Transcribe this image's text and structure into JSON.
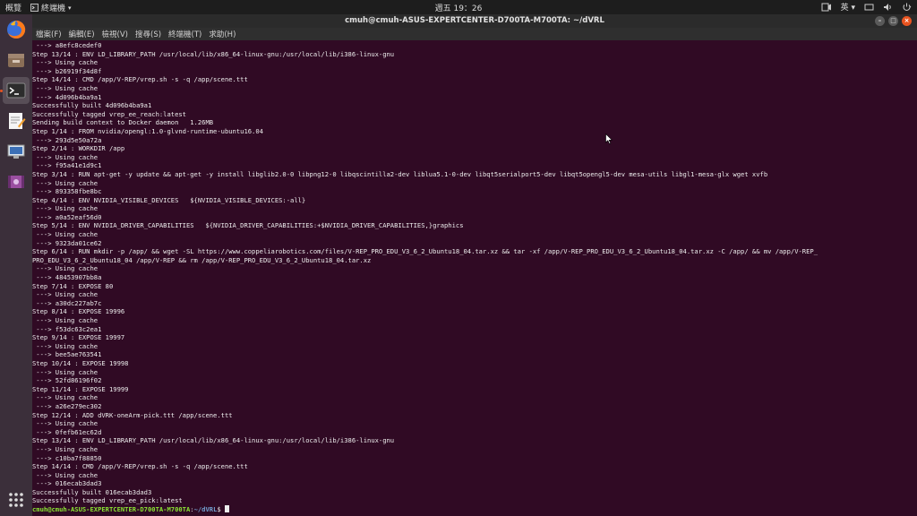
{
  "topbar": {
    "activities": "概覽",
    "app_menu": "終端機",
    "clock": "週五 19：26",
    "input_method": "英"
  },
  "dock": {
    "items": [
      {
        "name": "firefox",
        "icon": "firefox-icon"
      },
      {
        "name": "files",
        "icon": "files-icon"
      },
      {
        "name": "terminal",
        "icon": "terminal-icon"
      },
      {
        "name": "text-editor",
        "icon": "text-editor-icon"
      },
      {
        "name": "installer",
        "icon": "installer-icon"
      },
      {
        "name": "video",
        "icon": "video-icon"
      },
      {
        "name": "show-apps",
        "icon": "apps-grid-icon"
      }
    ]
  },
  "window": {
    "title": "cmuh@cmuh-ASUS-EXPERTCENTER-D700TA-M700TA: ~/dVRL",
    "menu": [
      "檔案(F)",
      "編輯(E)",
      "檢視(V)",
      "搜尋(S)",
      "終端機(T)",
      "求助(H)"
    ]
  },
  "terminal": {
    "lines": [
      " ---> a8efc8cedef0",
      "Step 13/14 : ENV LD_LIBRARY_PATH /usr/local/lib/x86_64-linux-gnu:/usr/local/lib/i386-linux-gnu",
      " ---> Using cache",
      " ---> b26919f34d8f",
      "Step 14/14 : CMD /app/V-REP/vrep.sh -s -q /app/scene.ttt",
      " ---> Using cache",
      " ---> 4d096b4ba9a1",
      "Successfully built 4d096b4ba9a1",
      "Successfully tagged vrep_ee_reach:latest",
      "Sending build context to Docker daemon   1.26MB",
      "Step 1/14 : FROM nvidia/opengl:1.0-glvnd-runtime-ubuntu16.04",
      " ---> 293d5e50a72a",
      "Step 2/14 : WORKDIR /app",
      " ---> Using cache",
      " ---> f95a41e1d9c1",
      "Step 3/14 : RUN apt-get -y update && apt-get -y install libglib2.0-0 libpng12-0 libqscintilla2-dev liblua5.1-0-dev libqt5serialport5-dev libqt5opengl5-dev mesa-utils libgl1-mesa-glx wget xvfb",
      " ---> Using cache",
      " ---> 893358fbe8bc",
      "Step 4/14 : ENV NVIDIA_VISIBLE_DEVICES   ${NVIDIA_VISIBLE_DEVICES:-all}",
      " ---> Using cache",
      " ---> a0a52eaf56d0",
      "Step 5/14 : ENV NVIDIA_DRIVER_CAPABILITIES   ${NVIDIA_DRIVER_CAPABILITIES:+$NVIDIA_DRIVER_CAPABILITIES,}graphics",
      " ---> Using cache",
      " ---> 9323da01ce62",
      "Step 6/14 : RUN mkdir -p /app/ && wget -SL https://www.coppeliarobotics.com/files/V-REP_PRO_EDU_V3_6_2_Ubuntu18_04.tar.xz && tar -xf /app/V-REP_PRO_EDU_V3_6_2_Ubuntu18_04.tar.xz -C /app/ && mv /app/V-REP_",
      "PRO_EDU_V3_6_2_Ubuntu18_04 /app/V-REP && rm /app/V-REP_PRO_EDU_V3_6_2_Ubuntu18_04.tar.xz",
      " ---> Using cache",
      " ---> 48453907bb8a",
      "Step 7/14 : EXPOSE 80",
      " ---> Using cache",
      " ---> a30dc227ab7c",
      "Step 8/14 : EXPOSE 19996",
      " ---> Using cache",
      " ---> f53dc63c2ea1",
      "Step 9/14 : EXPOSE 19997",
      " ---> Using cache",
      " ---> bee5ae763541",
      "Step 10/14 : EXPOSE 19998",
      " ---> Using cache",
      " ---> 52fd86196f02",
      "Step 11/14 : EXPOSE 19999",
      " ---> Using cache",
      " ---> a26e279ec302",
      "Step 12/14 : ADD dVRK-oneArm-pick.ttt /app/scene.ttt",
      " ---> Using cache",
      " ---> 0fefb61ec62d",
      "Step 13/14 : ENV LD_LIBRARY_PATH /usr/local/lib/x86_64-linux-gnu:/usr/local/lib/i386-linux-gnu",
      " ---> Using cache",
      " ---> c10ba7f88850",
      "Step 14/14 : CMD /app/V-REP/vrep.sh -s -q /app/scene.ttt",
      " ---> Using cache",
      " ---> 016ecab3dad3",
      "Successfully built 016ecab3dad3",
      "Successfully tagged vrep_ee_pick:latest"
    ],
    "prompt_user": "cmuh@cmuh-ASUS-EXPERTCENTER-D700TA-M700TA",
    "prompt_sep": ":",
    "prompt_path": "~/dVRL",
    "prompt_tail": "$ "
  },
  "colors": {
    "terminal_bg": "#300a24",
    "prompt_user": "#8ae234",
    "prompt_path": "#729fcf",
    "accent": "#e95420"
  }
}
